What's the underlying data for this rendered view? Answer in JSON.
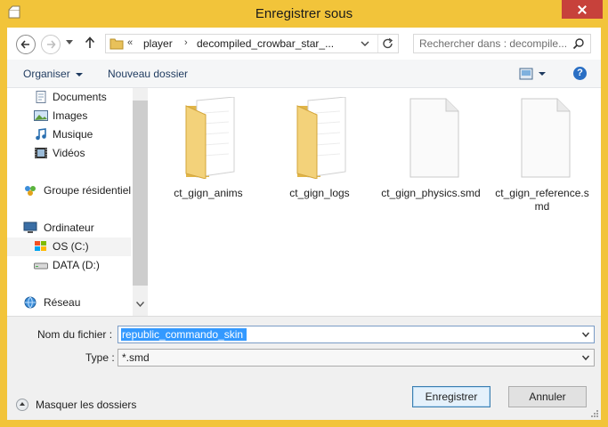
{
  "window": {
    "title": "Enregistrer sous"
  },
  "address": {
    "overflow": "«",
    "crumbs": [
      "player",
      "decompiled_crowbar_star_..."
    ]
  },
  "search": {
    "placeholder": "Rechercher dans : decompile..."
  },
  "toolbar": {
    "organize": "Organiser",
    "new_folder": "Nouveau dossier",
    "help": "?"
  },
  "nav": {
    "items": [
      {
        "label": "Documents",
        "icon": "documents-icon"
      },
      {
        "label": "Images",
        "icon": "images-icon"
      },
      {
        "label": "Musique",
        "icon": "music-icon"
      },
      {
        "label": "Vidéos",
        "icon": "videos-icon"
      },
      {
        "label": "Groupe résidentiel",
        "icon": "homegroup-icon"
      },
      {
        "label": "Ordinateur",
        "icon": "computer-icon"
      },
      {
        "label": "OS (C:)",
        "icon": "drive-c-icon"
      },
      {
        "label": "DATA (D:)",
        "icon": "drive-d-icon"
      },
      {
        "label": "Réseau",
        "icon": "network-icon"
      }
    ]
  },
  "files": [
    {
      "name": "ct_gign_anims",
      "type": "folder"
    },
    {
      "name": "ct_gign_logs",
      "type": "folder"
    },
    {
      "name": "ct_gign_physics.smd",
      "type": "file"
    },
    {
      "name": "ct_gign_reference.smd",
      "type": "file"
    }
  ],
  "form": {
    "filename_label": "Nom du fichier :",
    "filename_value": "republic_commando_skin",
    "type_label": "Type :",
    "type_value": "*.smd",
    "hide_folders": "Masquer les dossiers",
    "save_button": "Enregistrer",
    "cancel_button": "Annuler"
  },
  "colors": {
    "frame": "#f2c43a",
    "close": "#c7413b",
    "selection": "#3399ff"
  }
}
